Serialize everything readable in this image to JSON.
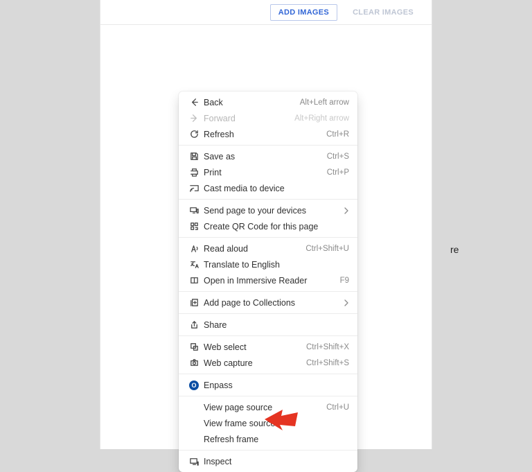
{
  "topbar": {
    "add_images": "ADD IMAGES",
    "clear_images": "CLEAR IMAGES"
  },
  "background_hint_text": "re",
  "context_menu": {
    "groups": [
      [
        {
          "id": "back",
          "icon": "arrow-left-icon",
          "label": "Back",
          "shortcut": "Alt+Left arrow",
          "disabled": false
        },
        {
          "id": "forward",
          "icon": "arrow-right-icon",
          "label": "Forward",
          "shortcut": "Alt+Right arrow",
          "disabled": true
        },
        {
          "id": "refresh",
          "icon": "refresh-icon",
          "label": "Refresh",
          "shortcut": "Ctrl+R",
          "disabled": false
        }
      ],
      [
        {
          "id": "save-as",
          "icon": "save-icon",
          "label": "Save as",
          "shortcut": "Ctrl+S"
        },
        {
          "id": "print",
          "icon": "print-icon",
          "label": "Print",
          "shortcut": "Ctrl+P"
        },
        {
          "id": "cast",
          "icon": "cast-icon",
          "label": "Cast media to device",
          "shortcut": ""
        }
      ],
      [
        {
          "id": "send",
          "icon": "devices-icon",
          "label": "Send page to your devices",
          "shortcut": "",
          "submenu": true
        },
        {
          "id": "qr",
          "icon": "qr-icon",
          "label": "Create QR Code for this page",
          "shortcut": ""
        }
      ],
      [
        {
          "id": "read-aloud",
          "icon": "read-aloud-icon",
          "label": "Read aloud",
          "shortcut": "Ctrl+Shift+U"
        },
        {
          "id": "translate",
          "icon": "translate-icon",
          "label": "Translate to English",
          "shortcut": ""
        },
        {
          "id": "immersive",
          "icon": "book-icon",
          "label": "Open in Immersive Reader",
          "shortcut": "F9"
        }
      ],
      [
        {
          "id": "collections",
          "icon": "collections-icon",
          "label": "Add page to Collections",
          "shortcut": "",
          "submenu": true
        }
      ],
      [
        {
          "id": "share",
          "icon": "share-icon",
          "label": "Share",
          "shortcut": ""
        }
      ],
      [
        {
          "id": "web-select",
          "icon": "webselect-icon",
          "label": "Web select",
          "shortcut": "Ctrl+Shift+X"
        },
        {
          "id": "web-capture",
          "icon": "capture-icon",
          "label": "Web capture",
          "shortcut": "Ctrl+Shift+S"
        }
      ],
      [
        {
          "id": "enpass",
          "icon": "enpass-icon",
          "label": "Enpass",
          "shortcut": ""
        }
      ],
      [
        {
          "id": "view-source",
          "icon": "",
          "label": "View page source",
          "shortcut": "Ctrl+U"
        },
        {
          "id": "view-frame-source",
          "icon": "",
          "label": "View frame source",
          "shortcut": ""
        },
        {
          "id": "refresh-frame",
          "icon": "",
          "label": "Refresh frame",
          "shortcut": ""
        }
      ],
      [
        {
          "id": "inspect",
          "icon": "inspect-icon",
          "label": "Inspect",
          "shortcut": ""
        }
      ]
    ]
  },
  "annotation": {
    "arrow_color": "#e53422",
    "points_to": "inspect"
  }
}
